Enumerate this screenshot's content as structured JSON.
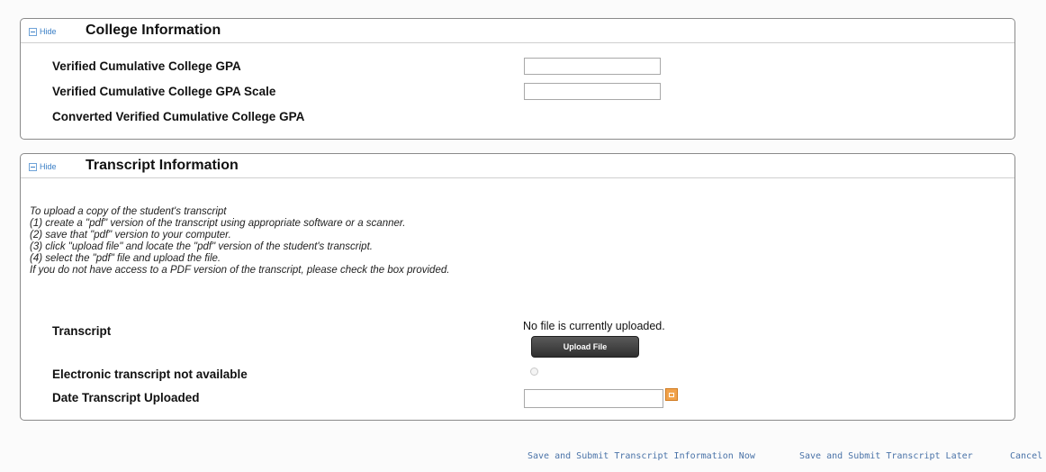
{
  "college_section": {
    "toggle_label": "Hide",
    "title": "College Information",
    "fields": [
      {
        "label": "Verified Cumulative College GPA",
        "value": ""
      },
      {
        "label": "Verified Cumulative College GPA Scale",
        "value": ""
      },
      {
        "label": "Converted Verified Cumulative College GPA",
        "value": ""
      }
    ]
  },
  "transcript_section": {
    "toggle_label": "Hide",
    "title": "Transcript Information",
    "instructions": [
      "To upload a copy of the student's transcript",
      "(1) create a \"pdf\" version of the transcript using appropriate software or a scanner.",
      "(2) save that \"pdf\" version to your computer.",
      "(3) click \"upload file\" and locate the \"pdf\" version of the student's transcript.",
      "(4) select the \"pdf\" file and upload the file.",
      "If you do not have access to a PDF version of the transcript, please check the box provided."
    ],
    "transcript_label": "Transcript",
    "no_file_text": "No file is currently uploaded.",
    "upload_button": "Upload File",
    "not_available_label": "Electronic transcript not available",
    "not_available_checked": false,
    "date_label": "Date Transcript Uploaded",
    "date_value": "",
    "calendar_icon": "calendar-icon"
  },
  "footer": {
    "submit_now": "Save and Submit Transcript Information Now",
    "submit_later": "Save and Submit Transcript Later",
    "cancel": "Cancel"
  }
}
